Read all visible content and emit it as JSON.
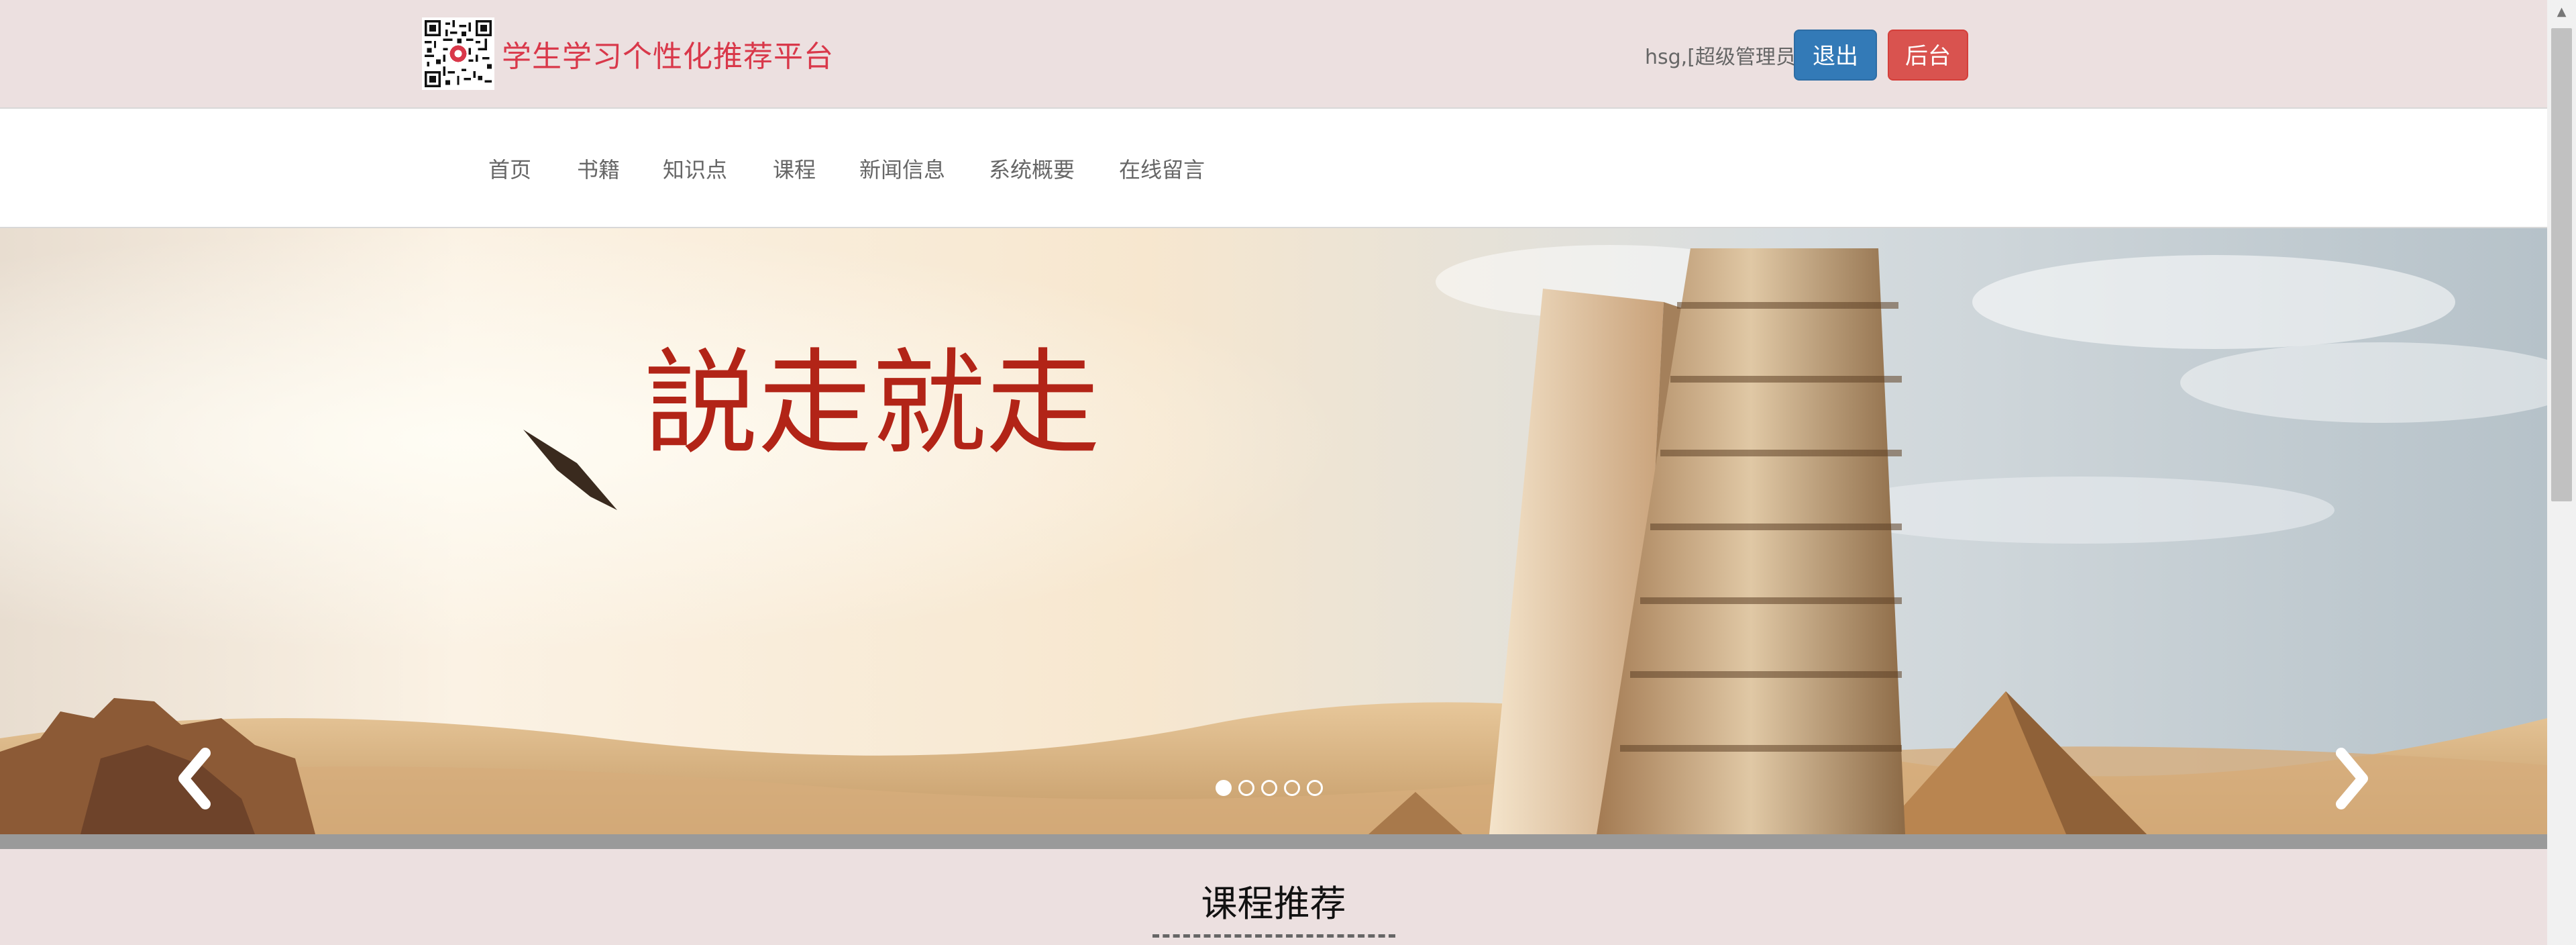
{
  "header": {
    "site_title": "学生学习个性化推荐平台",
    "user_info": "hsg,[超级管理员]",
    "logout_label": "退出",
    "admin_label": "后台",
    "qr_icon": "qr-code-icon"
  },
  "nav": {
    "items": [
      "首页",
      "书籍",
      "知识点",
      "课程",
      "新闻信息",
      "系统概要",
      "在线留言"
    ]
  },
  "carousel": {
    "slide_count": 5,
    "active_index": 0,
    "prev_icon": "chevron-left-icon",
    "next_icon": "chevron-right-icon",
    "banner_text": "説走就走"
  },
  "section": {
    "title": "课程推荐"
  },
  "colors": {
    "title_red": "#d9384a",
    "logout_blue": "#337ab7",
    "admin_red": "#d9534f",
    "page_bg": "#ece0e0"
  }
}
